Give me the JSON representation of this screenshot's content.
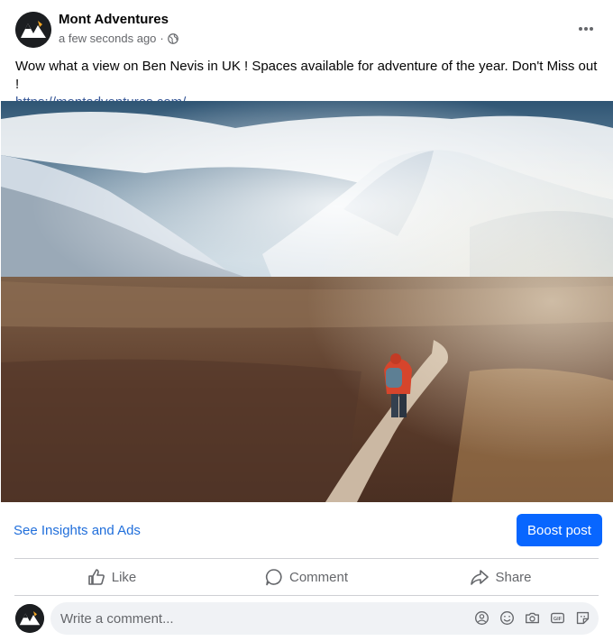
{
  "post": {
    "page_name": "Mont Adventures",
    "timestamp": "a few seconds ago",
    "separator": "·",
    "privacy_icon": "globe-icon",
    "text": "Wow what a view on Ben Nevis in UK ! Spaces available for adventure of the year. Don't Miss out !",
    "link": "https://montadventures.com/",
    "image_alt": "Hiker in red jacket walking a path toward snowy Ben Nevis mountains"
  },
  "insights": {
    "link_label": "See Insights and Ads",
    "boost_label": "Boost post"
  },
  "actions": {
    "like": "Like",
    "comment": "Comment",
    "share": "Share"
  },
  "comment_box": {
    "placeholder": "Write a comment...",
    "icons": [
      "avatar-sticker-icon",
      "emoji-icon",
      "camera-icon",
      "gif-icon",
      "sticker-icon"
    ]
  },
  "colors": {
    "accent": "#0866ff",
    "link": "#216fdb",
    "secondary_text": "#65676b"
  }
}
